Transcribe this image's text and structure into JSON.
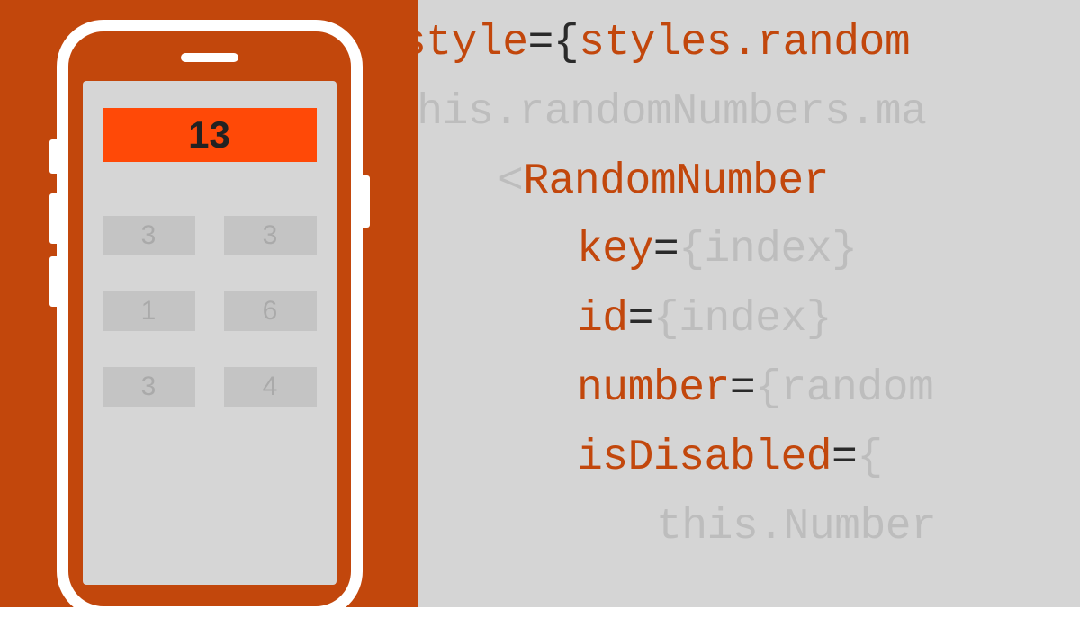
{
  "phone": {
    "target": "13",
    "tiles": [
      "3",
      "3",
      "1",
      "6",
      "3",
      "4"
    ]
  },
  "code": {
    "line1_attr": "style",
    "line1_eq": "=",
    "line1_brace": "{",
    "line1_val": "styles.random",
    "line2_faded": "this.randomNumbers.ma",
    "line3_lt": "<",
    "line3_comp": "RandomNumber",
    "line4_attr": "key",
    "line4_eq": "=",
    "line4_val": "{index}",
    "line5_attr": "id",
    "line5_eq": "=",
    "line5_val": "{index}",
    "line6_attr": "number",
    "line6_eq": "=",
    "line6_val": "{random",
    "line7_attr": "isDisabled",
    "line7_eq": "=",
    "line7_val": "{",
    "line8_faded": "this.Number"
  }
}
